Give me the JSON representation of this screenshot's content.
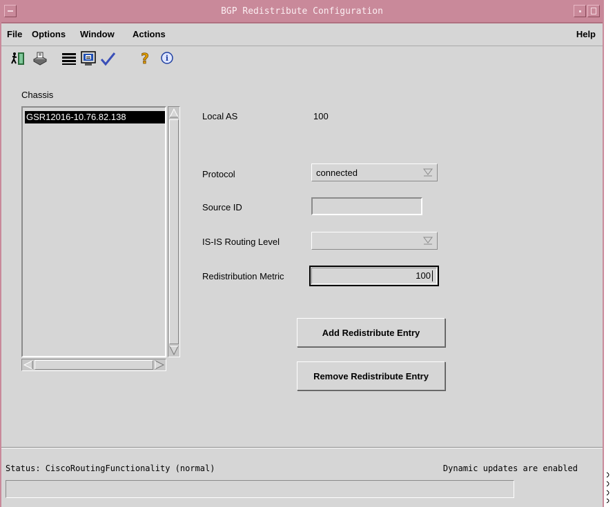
{
  "window": {
    "title": "BGP Redistribute Configuration"
  },
  "menubar": {
    "items": [
      "File",
      "Options",
      "Window",
      "Actions"
    ],
    "help": "Help"
  },
  "toolbar": {
    "icons": [
      "exit-icon",
      "printer-icon",
      "list-icon",
      "monitor-icon",
      "check-icon",
      "help-icon",
      "info-icon"
    ]
  },
  "chassis": {
    "label": "Chassis",
    "items": [
      "GSR12016-10.76.82.138"
    ],
    "selected_index": 0
  },
  "form": {
    "local_as_label": "Local AS",
    "local_as_value": "100",
    "protocol_label": "Protocol",
    "protocol_value": "connected",
    "source_id_label": "Source ID",
    "source_id_value": "",
    "isis_level_label": "IS-IS Routing Level",
    "isis_level_value": "",
    "metric_label": "Redistribution Metric",
    "metric_value": "100"
  },
  "buttons": {
    "add": "Add Redistribute Entry",
    "remove": "Remove Redistribute Entry"
  },
  "status": {
    "text": "Status: CiscoRoutingFunctionality (normal)",
    "updates": "Dynamic updates are enabled"
  },
  "colors": {
    "titlebar": "#c9899a",
    "window_bg": "#d6d6d6"
  }
}
